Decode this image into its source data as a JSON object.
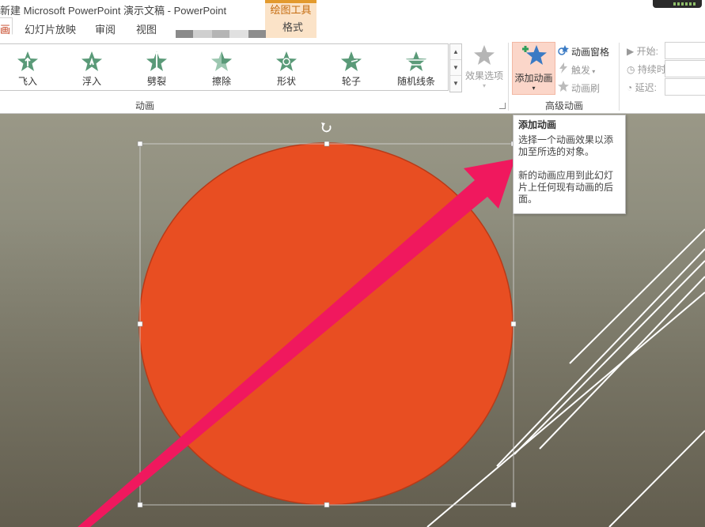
{
  "window": {
    "title": "新建 Microsoft PowerPoint 演示文稿 - PowerPoint",
    "context_header": "绘图工具"
  },
  "tabs": [
    "幻灯片放映",
    "审阅",
    "视图",
    "格式"
  ],
  "gallery": {
    "items": [
      "飞入",
      "浮入",
      "劈裂",
      "擦除",
      "形状",
      "轮子",
      "随机线条"
    ],
    "effect_options": "效果选项",
    "group_label": "动画"
  },
  "advanced": {
    "add_animation": "添加动画",
    "animation_pane": "动画窗格",
    "trigger": "触发",
    "animation_painter": "动画刷",
    "group_label": "高级动画"
  },
  "timing": {
    "start": "开始:",
    "duration": "持续时间:",
    "delay": "延迟:"
  },
  "tooltip": {
    "title": "添加动画",
    "line1": "选择一个动画效果以添加至所选的对象。",
    "line2": "新的动画应用到此幻灯片上任何现有动画的后面。"
  },
  "colors": {
    "accent_tab": "#c43e1c",
    "context_orange": "#e39a2d",
    "circle_fill": "#e84e22",
    "arrow": "#f0185e",
    "star": "#5a9a78"
  }
}
